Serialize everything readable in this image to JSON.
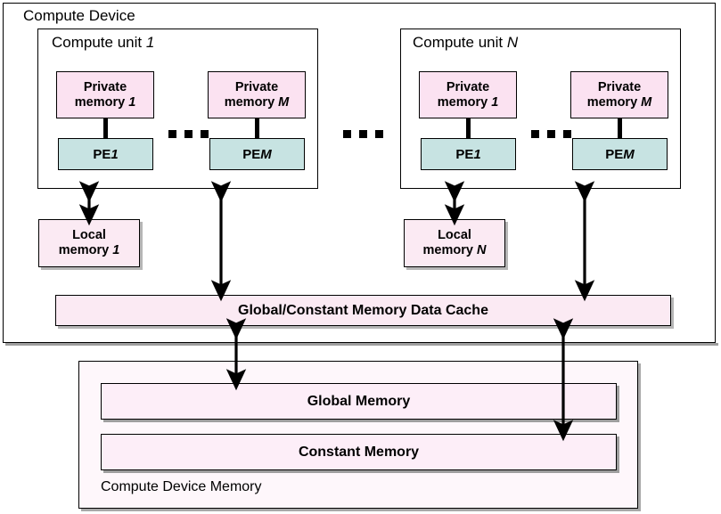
{
  "diagram": {
    "device_title": "Compute Device",
    "compute_units": [
      {
        "title_prefix": "Compute unit ",
        "title_index": "1",
        "columns": [
          {
            "private_label_line1": "Private",
            "private_label_line2": "memory ",
            "private_index": "1",
            "pe_label": "PE ",
            "pe_index": "1"
          },
          {
            "private_label_line1": "Private",
            "private_label_line2": "memory ",
            "private_index": "M",
            "pe_label": "PE ",
            "pe_index": "M"
          }
        ],
        "inner_ellipsis": "...",
        "local_memory_line1": "Local",
        "local_memory_line2": "memory ",
        "local_memory_index": "1"
      },
      {
        "title_prefix": "Compute unit ",
        "title_index": "N",
        "columns": [
          {
            "private_label_line1": "Private",
            "private_label_line2": "memory ",
            "private_index": "1",
            "pe_label": "PE ",
            "pe_index": "1"
          },
          {
            "private_label_line1": "Private",
            "private_label_line2": "memory ",
            "private_index": "M",
            "pe_label": "PE ",
            "pe_index": "M"
          }
        ],
        "inner_ellipsis": "...",
        "local_memory_line1": "Local",
        "local_memory_line2": "memory ",
        "local_memory_index": "N"
      }
    ],
    "between_units_ellipsis": "...",
    "cache_label": "Global/Constant Memory Data Cache",
    "device_memory": {
      "title": "Compute Device Memory",
      "bars": [
        {
          "label": "Global Memory"
        },
        {
          "label": "Constant Memory"
        }
      ]
    },
    "colors": {
      "private_memory_fill": "#fbe2f1",
      "pe_fill": "#c7e3e2",
      "local_memory_fill": "#fbeaf3",
      "cache_fill": "#fbeaf3",
      "device_memory_fill": "#fef7fb",
      "memory_bar_fill": "#fdeef8",
      "border": "#000000",
      "shadow": "#a8a8a8"
    }
  }
}
